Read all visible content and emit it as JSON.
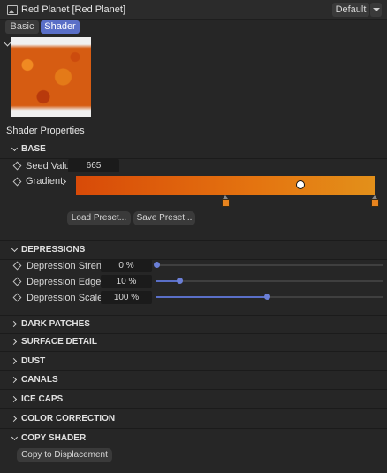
{
  "window": {
    "title": "Red Planet [Red Planet]",
    "preset_value": "Default"
  },
  "tabs": [
    {
      "label": "Basic",
      "active": false
    },
    {
      "label": "Shader",
      "active": true
    }
  ],
  "section_title": "Shader Properties",
  "base": {
    "header": "BASE",
    "seed_label": "Seed Value",
    "seed_value": "665",
    "gradient_label": "Gradient",
    "gradient_colors": [
      "#d84a08",
      "#e47410",
      "#e3901a"
    ],
    "load_preset": "Load Preset...",
    "save_preset": "Save Preset..."
  },
  "depressions": {
    "header": "DEPRESSIONS",
    "params": [
      {
        "label": "Depression Strength",
        "value": "0 %",
        "level": 0.0
      },
      {
        "label": "Depression Edge",
        "value": "10 %",
        "level": 0.1
      },
      {
        "label": "Depression Scale",
        "value": "100 %",
        "level": 0.49
      }
    ]
  },
  "collapsed_sections": [
    "DARK PATCHES",
    "SURFACE DETAIL",
    "DUST",
    "CANALS",
    "ICE CAPS",
    "COLOR CORRECTION"
  ],
  "copy_shader": {
    "header": "COPY SHADER",
    "button": "Copy to Displacement"
  },
  "colors": {
    "accent": "#5a6fc7",
    "background": "#262626"
  }
}
